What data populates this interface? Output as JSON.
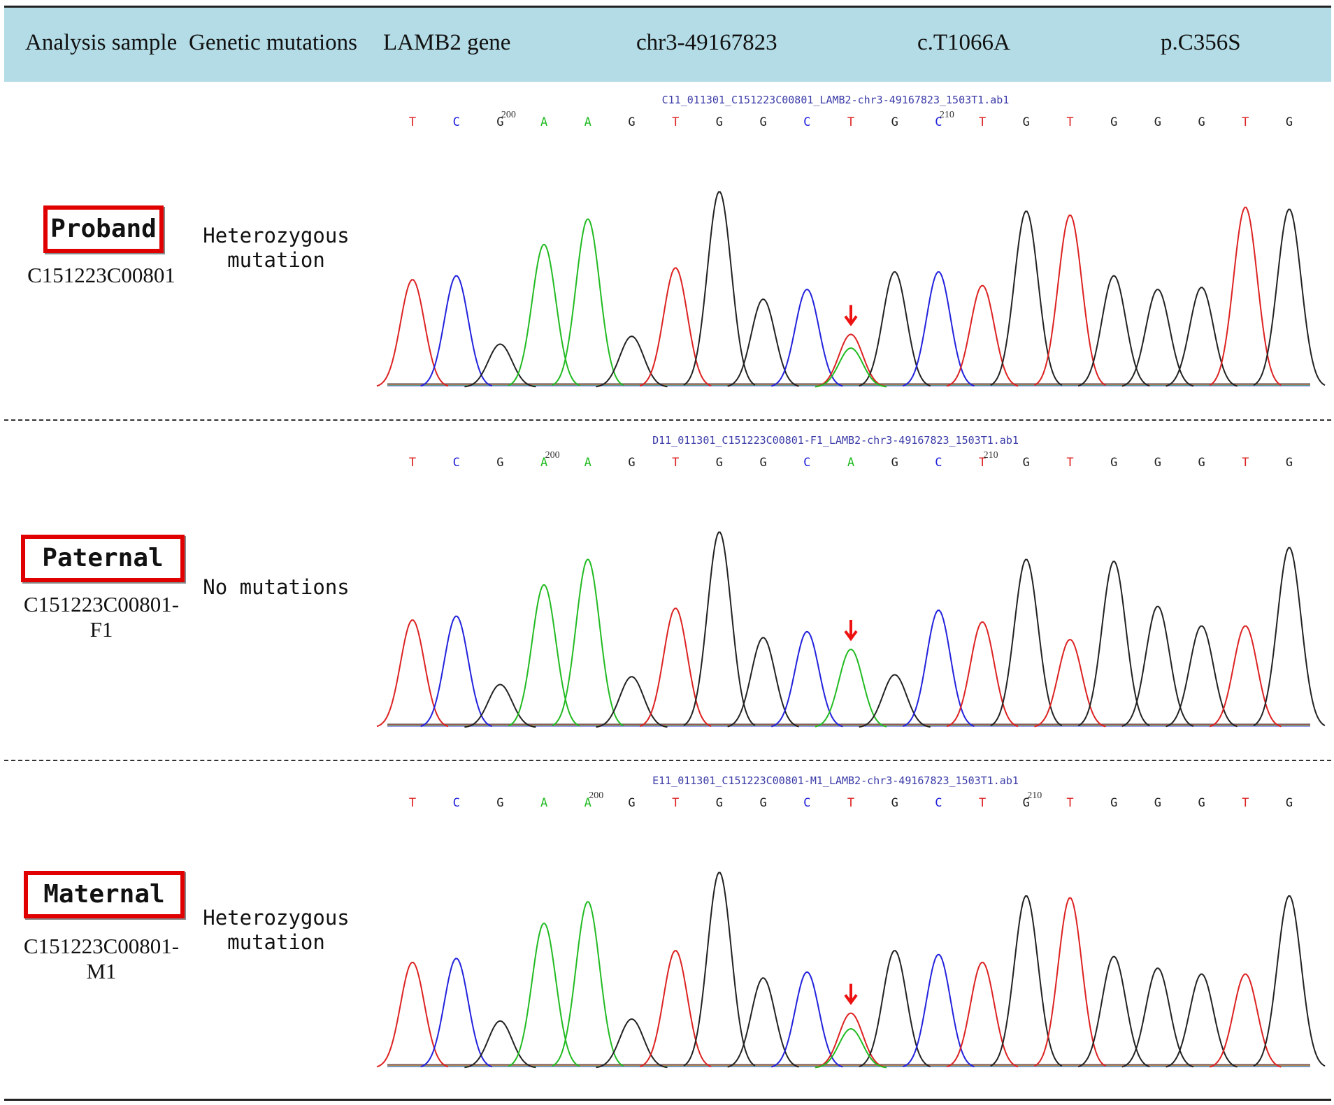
{
  "header": {
    "col1": "Analysis sample",
    "col2": "Genetic mutations",
    "col3": "LAMB2 gene",
    "col4": "chr3-49167823",
    "col5": "c.T1066A",
    "col6": "p.C356S"
  },
  "colors": {
    "A": "#22bb22",
    "C": "#2222dd",
    "G": "#222222",
    "T": "#dd2222",
    "marker": "#ee1111",
    "header_bg": "#b3dce6",
    "label_border": "#e00000"
  },
  "rows": [
    {
      "label": "Proband",
      "sample_id": [
        "C151223C00801"
      ],
      "mutation": [
        "Heterozygous",
        "mutation"
      ],
      "file": "C11_011301_C151223C00801_LAMB2-chr3-49167823_1503T1.ab1",
      "bases": [
        "T",
        "C",
        "G",
        "A",
        "A",
        "G",
        "T",
        "G",
        "G",
        "C",
        "T",
        "G",
        "C",
        "T",
        "G",
        "T",
        "G",
        "G",
        "G",
        "T",
        "G"
      ],
      "ticks": [
        {
          "label": "200",
          "index": 2
        },
        {
          "label": "210",
          "index": 12
        }
      ],
      "peaks": [
        0.55,
        0.57,
        0.22,
        0.73,
        0.86,
        0.26,
        0.61,
        1.0,
        0.45,
        0.5,
        0.27,
        0.59,
        0.59,
        0.52,
        0.9,
        0.88,
        0.57,
        0.5,
        0.51,
        0.92,
        0.91
      ],
      "secondary": {
        "index": 10,
        "base": "A",
        "height": 0.2
      }
    },
    {
      "label": "Paternal",
      "sample_id": [
        "C151223C00801-",
        "F1"
      ],
      "mutation": [
        "No mutations"
      ],
      "file": "D11_011301_C151223C00801-F1_LAMB2-chr3-49167823_1503T1.ab1",
      "bases": [
        "T",
        "C",
        "G",
        "A",
        "A",
        "G",
        "T",
        "G",
        "G",
        "C",
        "A",
        "G",
        "C",
        "T",
        "G",
        "T",
        "G",
        "G",
        "G",
        "T",
        "G"
      ],
      "ticks": [
        {
          "label": "200",
          "index": 3
        },
        {
          "label": "210",
          "index": 13
        }
      ],
      "peaks": [
        0.55,
        0.57,
        0.22,
        0.73,
        0.86,
        0.26,
        0.61,
        1.0,
        0.46,
        0.49,
        0.4,
        0.27,
        0.6,
        0.54,
        0.86,
        0.45,
        0.85,
        0.62,
        0.52,
        0.52,
        0.92
      ],
      "secondary": null
    },
    {
      "label": "Maternal",
      "sample_id": [
        "C151223C00801-",
        "M1"
      ],
      "mutation": [
        "Heterozygous",
        "mutation"
      ],
      "file": "E11_011301_C151223C00801-M1_LAMB2-chr3-49167823_1503T1.ab1",
      "bases": [
        "T",
        "C",
        "G",
        "A",
        "A",
        "G",
        "T",
        "G",
        "G",
        "C",
        "T",
        "G",
        "C",
        "T",
        "G",
        "T",
        "G",
        "G",
        "G",
        "T",
        "G"
      ],
      "ticks": [
        {
          "label": "200",
          "index": 4
        },
        {
          "label": "210",
          "index": 14
        }
      ],
      "peaks": [
        0.54,
        0.56,
        0.24,
        0.74,
        0.85,
        0.25,
        0.6,
        1.0,
        0.46,
        0.49,
        0.28,
        0.6,
        0.58,
        0.54,
        0.88,
        0.87,
        0.57,
        0.51,
        0.48,
        0.48,
        0.88
      ],
      "secondary": {
        "index": 10,
        "base": "A",
        "height": 0.2
      }
    }
  ],
  "chart_data": [
    {
      "type": "chromatogram",
      "series": "Proband",
      "bases": "TCGAAGTGGCTGCTGTGGGTG",
      "mutation_position": 11,
      "mutation_call": "T/A"
    },
    {
      "type": "chromatogram",
      "series": "Paternal",
      "bases": "TCGAAGTGGCAGCTGTGGGTG",
      "mutation_position": 11,
      "mutation_call": "A"
    },
    {
      "type": "chromatogram",
      "series": "Maternal",
      "bases": "TCGAAGTGGCTGCTGTGGGTG",
      "mutation_position": 11,
      "mutation_call": "T/A"
    }
  ]
}
